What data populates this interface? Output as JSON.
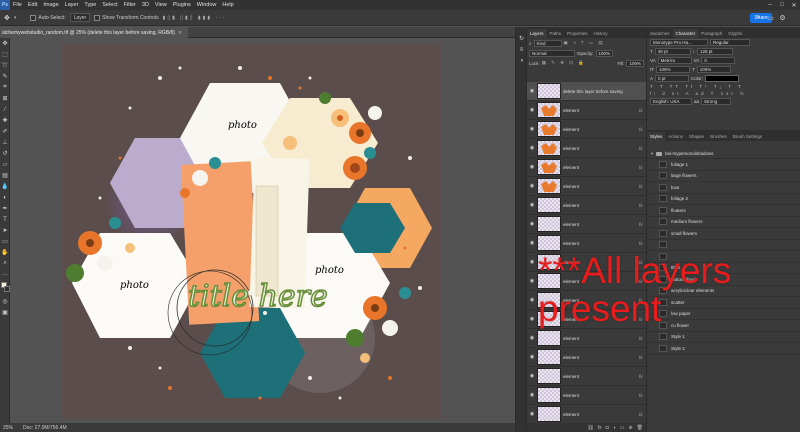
{
  "menubar": {
    "logo": "Ps",
    "items": [
      "File",
      "Edit",
      "Image",
      "Layer",
      "Type",
      "Select",
      "Filter",
      "3D",
      "View",
      "Plugins",
      "Window",
      "Help"
    ]
  },
  "options": {
    "auto_select_label": "Auto-Select:",
    "auto_select_value": "Layer",
    "transform_label": "Show Transform Controls",
    "share_label": "Share"
  },
  "document": {
    "tab_title": "alchemywebstudio_random.tif @ 25% (delete this layer before saving, RGB/8)",
    "zoom": "25%",
    "doc_size": "Doc: 27.0M/756.4M",
    "photo_labels": [
      "photo",
      "photo",
      "photo"
    ],
    "title_text": "title here"
  },
  "layers_panel": {
    "tabs": [
      "Layers",
      "Paths",
      "Properties",
      "History"
    ],
    "kind_label": "Kind",
    "blend_mode": "Normal",
    "opacity_label": "Opacity:",
    "opacity_value": "100%",
    "lock_label": "Lock:",
    "fill_label": "Fill:",
    "fill_value": "100%",
    "layers": [
      {
        "name": "delete this layer before saving",
        "fx": "",
        "orange": false
      },
      {
        "name": "element",
        "fx": "fx",
        "orange": true
      },
      {
        "name": "element",
        "fx": "fx",
        "orange": true
      },
      {
        "name": "element",
        "fx": "fx",
        "orange": true
      },
      {
        "name": "element",
        "fx": "fx",
        "orange": true
      },
      {
        "name": "element",
        "fx": "fx",
        "orange": true
      },
      {
        "name": "element",
        "fx": "fx",
        "orange": false
      },
      {
        "name": "element",
        "fx": "fx",
        "orange": false
      },
      {
        "name": "element",
        "fx": "fx",
        "orange": false
      },
      {
        "name": "element",
        "fx": "fx",
        "orange": false
      },
      {
        "name": "element",
        "fx": "fx",
        "orange": false
      },
      {
        "name": "element",
        "fx": "fx",
        "orange": false
      },
      {
        "name": "element",
        "fx": "fx",
        "orange": false
      },
      {
        "name": "element",
        "fx": "fx",
        "orange": false
      },
      {
        "name": "element",
        "fx": "fx",
        "orange": false
      },
      {
        "name": "element",
        "fx": "fx",
        "orange": false
      },
      {
        "name": "element",
        "fx": "fx",
        "orange": false
      },
      {
        "name": "element",
        "fx": "fx",
        "orange": false
      }
    ]
  },
  "right_panel": {
    "top_tabs": [
      "Swatches",
      "Character",
      "Paragraph",
      "Glyphs"
    ],
    "font_family": "Monotype Pro Ha...",
    "font_style": "Regular",
    "font_size": "48 pt",
    "leading": "128 pt",
    "kerning": "Metrics",
    "tracking": "0",
    "scale": "100%",
    "baseline": "0 pt",
    "color_label": "Color:",
    "language": "English: USA",
    "antialias": "Strong",
    "style_tabs": [
      "Styles",
      "Actions",
      "Shapes",
      "Brushes",
      "Brush Settings"
    ],
    "group_name": "bsi-mypersonalshadows",
    "styles": [
      "foliage 1",
      "large flowers",
      "bow",
      "foliage 2",
      "floaters",
      "medium flowers",
      "small flowers",
      "",
      "",
      "titles",
      "buttons/brad",
      "acrylic/clear elements",
      "scatter",
      "low paper",
      "cu flower",
      "Style 1",
      "Style 2"
    ]
  },
  "overlay": {
    "line1": "***All layers",
    "line2": "present"
  }
}
